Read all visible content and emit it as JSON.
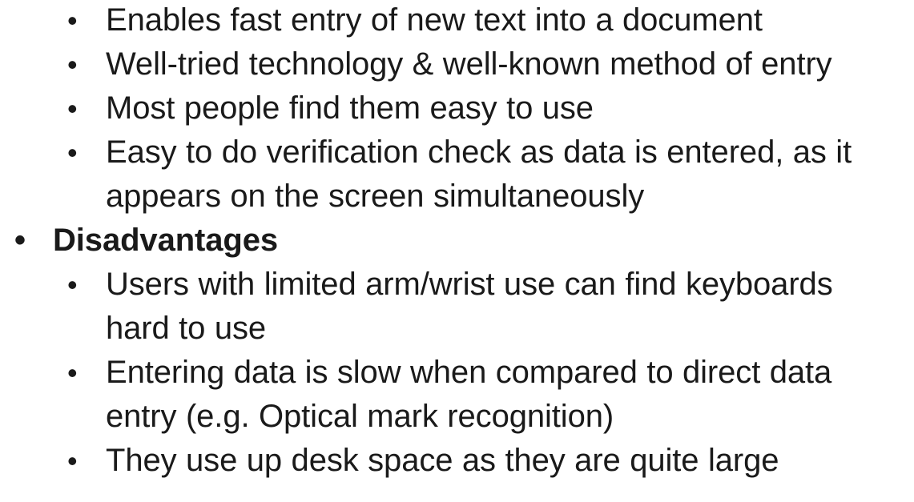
{
  "slide": {
    "background_color": "#ffffff",
    "text_color": "#1a1a1a",
    "bullet_glyph": "•",
    "items": [
      {
        "level": 2,
        "bold": false,
        "text": "Enables fast entry of new text into a document"
      },
      {
        "level": 2,
        "bold": false,
        "text": "Well-tried technology & well-known method of entry"
      },
      {
        "level": 2,
        "bold": false,
        "text": "Most people find them easy to use"
      },
      {
        "level": 2,
        "bold": false,
        "text": "Easy to do verification check as data is entered, as it appears on the screen simultaneously"
      },
      {
        "level": 1,
        "bold": true,
        "text": "Disadvantages"
      },
      {
        "level": 2,
        "bold": false,
        "text": "Users with limited arm/wrist use can find keyboards hard to use"
      },
      {
        "level": 2,
        "bold": false,
        "text": "Entering data is slow when compared to direct data entry (e.g. Optical mark recognition)"
      },
      {
        "level": 2,
        "bold": false,
        "text": "They use up desk space as they are quite large"
      }
    ]
  }
}
